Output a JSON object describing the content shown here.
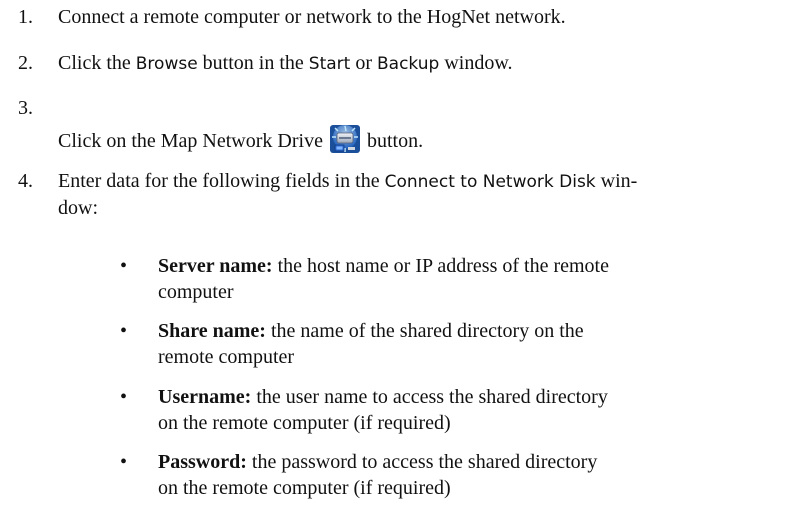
{
  "steps": [
    {
      "number": "1.",
      "text": "Connect a remote computer or network to the HogNet network."
    },
    {
      "number": "2.",
      "pre": "Click the ",
      "ui1": "Browse",
      "mid": " button in the ",
      "ui2": "Start",
      "mid2": " or ",
      "ui3": "Backup",
      "post": " window."
    },
    {
      "number": "3.",
      "pre": "Click on the Map Network Drive ",
      "post": " button.",
      "icon": "map-network-drive-icon"
    },
    {
      "number": "4.",
      "pre": "Enter data for the following fields in the ",
      "ui1": "Connect to Network Disk",
      "post": " win-",
      "line2": "dow:"
    }
  ],
  "fields": [
    {
      "label": "Server name:",
      "line1": " the host name or IP address of the remote",
      "line2": "computer"
    },
    {
      "label": "Share name:",
      "line1": " the name of the shared directory on the",
      "line2": "remote computer"
    },
    {
      "label": "Username:",
      "line1": " the user name to access the shared directory",
      "line2": "on the remote computer (if required)"
    },
    {
      "label": "Password:",
      "line1": " the password to access the shared directory",
      "line2": "on the remote computer (if required)"
    }
  ],
  "bullet": "•"
}
